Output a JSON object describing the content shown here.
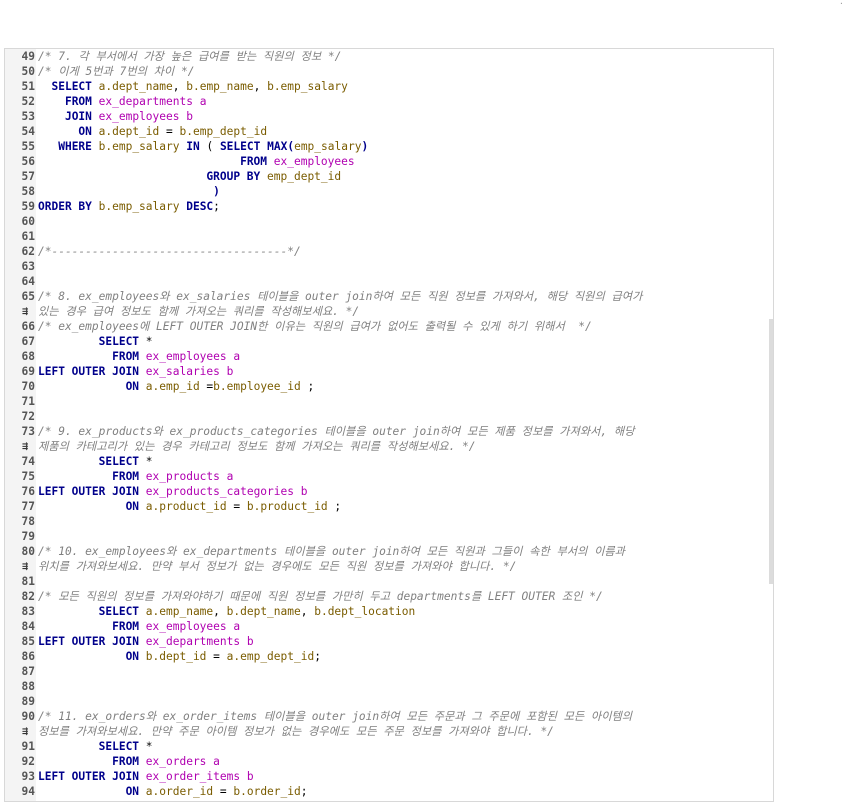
{
  "editor": {
    "lines": [
      {
        "n": "49",
        "t": [
          [
            "cm",
            "/* 7. 각 부서에서 가장 높은 급여를 받는 직원의 정보 */"
          ]
        ]
      },
      {
        "n": "50",
        "t": [
          [
            "cm",
            "/* 이게 5번과 7번의 차이 */"
          ]
        ]
      },
      {
        "n": "51",
        "t": [
          [
            "pl",
            "  "
          ],
          [
            "kw",
            "SELECT"
          ],
          [
            "pl",
            " "
          ],
          [
            "id",
            "a.dept_name"
          ],
          [
            "pl",
            ", "
          ],
          [
            "id",
            "b.emp_name"
          ],
          [
            "pl",
            ", "
          ],
          [
            "id",
            "b.emp_salary"
          ]
        ]
      },
      {
        "n": "52",
        "t": [
          [
            "pl",
            "    "
          ],
          [
            "kw",
            "FROM"
          ],
          [
            "pl",
            " "
          ],
          [
            "tb",
            "ex_departments"
          ],
          [
            "pl",
            " "
          ],
          [
            "tb",
            "a"
          ]
        ]
      },
      {
        "n": "53",
        "t": [
          [
            "pl",
            "    "
          ],
          [
            "kw",
            "JOIN"
          ],
          [
            "pl",
            " "
          ],
          [
            "tb",
            "ex_employees"
          ],
          [
            "pl",
            " "
          ],
          [
            "tb",
            "b"
          ]
        ]
      },
      {
        "n": "54",
        "t": [
          [
            "pl",
            "      "
          ],
          [
            "kw",
            "ON"
          ],
          [
            "pl",
            " "
          ],
          [
            "id",
            "a.dept_id"
          ],
          [
            "pl",
            " = "
          ],
          [
            "id",
            "b.emp_dept_id"
          ]
        ]
      },
      {
        "n": "55",
        "t": [
          [
            "pl",
            "   "
          ],
          [
            "kw",
            "WHERE"
          ],
          [
            "pl",
            " "
          ],
          [
            "id",
            "b.emp_salary"
          ],
          [
            "pl",
            " "
          ],
          [
            "kw",
            "IN"
          ],
          [
            "pl",
            " ( "
          ],
          [
            "kw",
            "SELECT"
          ],
          [
            "pl",
            " "
          ],
          [
            "kw",
            "MAX"
          ],
          [
            "pn",
            "("
          ],
          [
            "id",
            "emp_salary"
          ],
          [
            "pn",
            ")"
          ]
        ]
      },
      {
        "n": "56",
        "t": [
          [
            "pl",
            "                              "
          ],
          [
            "kw",
            "FROM"
          ],
          [
            "pl",
            " "
          ],
          [
            "tb",
            "ex_employees"
          ]
        ]
      },
      {
        "n": "57",
        "t": [
          [
            "pl",
            "                         "
          ],
          [
            "kw",
            "GROUP BY"
          ],
          [
            "pl",
            " "
          ],
          [
            "id",
            "emp_dept_id"
          ]
        ]
      },
      {
        "n": "58",
        "t": [
          [
            "pl",
            "                          "
          ],
          [
            "pn",
            ")"
          ]
        ]
      },
      {
        "n": "59",
        "t": [
          [
            "kw",
            "ORDER BY"
          ],
          [
            "pl",
            " "
          ],
          [
            "id",
            "b.emp_salary"
          ],
          [
            "pl",
            " "
          ],
          [
            "kw",
            "DESC"
          ],
          [
            "pl",
            ";"
          ]
        ]
      },
      {
        "n": "60",
        "t": []
      },
      {
        "n": "61",
        "t": []
      },
      {
        "n": "62",
        "t": [
          [
            "cm",
            "/*-----------------------------------*/"
          ]
        ]
      },
      {
        "n": "63",
        "t": []
      },
      {
        "n": "64",
        "t": []
      },
      {
        "n": "65",
        "t": [
          [
            "cm",
            "/* 8. ex_employees와 ex_salaries 테이블을 outer join하여 모든 직원 정보를 가져와서, 해당 직원의 급여가"
          ]
        ]
      },
      {
        "n": "",
        "w": true,
        "t": [
          [
            "cm",
            "있는 경우 급여 정보도 함께 가져오는 쿼리를 작성해보세요. */"
          ]
        ]
      },
      {
        "n": "66",
        "t": [
          [
            "cm",
            "/* ex_employees에 LEFT OUTER JOIN한 이유는 직원의 급여가 없어도 출력될 수 있게 하기 위해서  */"
          ]
        ]
      },
      {
        "n": "67",
        "t": [
          [
            "pl",
            "         "
          ],
          [
            "kw",
            "SELECT"
          ],
          [
            "pl",
            " *"
          ]
        ]
      },
      {
        "n": "68",
        "t": [
          [
            "pl",
            "           "
          ],
          [
            "kw",
            "FROM"
          ],
          [
            "pl",
            " "
          ],
          [
            "tb",
            "ex_employees"
          ],
          [
            "pl",
            " "
          ],
          [
            "tb",
            "a"
          ]
        ]
      },
      {
        "n": "69",
        "t": [
          [
            "kw",
            "LEFT OUTER JOIN"
          ],
          [
            "pl",
            " "
          ],
          [
            "tb",
            "ex_salaries"
          ],
          [
            "pl",
            " "
          ],
          [
            "tb",
            "b"
          ]
        ]
      },
      {
        "n": "70",
        "t": [
          [
            "pl",
            "             "
          ],
          [
            "kw",
            "ON"
          ],
          [
            "pl",
            " "
          ],
          [
            "id",
            "a.emp_id"
          ],
          [
            "pl",
            " ="
          ],
          [
            "id",
            "b.employee_id"
          ],
          [
            "pl",
            " ;"
          ]
        ]
      },
      {
        "n": "71",
        "t": []
      },
      {
        "n": "72",
        "t": []
      },
      {
        "n": "73",
        "t": [
          [
            "cm",
            "/* 9. ex_products와 ex_products_categories 테이블을 outer join하여 모든 제품 정보를 가져와서, 해당"
          ]
        ]
      },
      {
        "n": "",
        "w": true,
        "t": [
          [
            "cm",
            "제품의 카테고리가 있는 경우 카테고리 정보도 함께 가져오는 쿼리를 작성해보세요. */"
          ]
        ]
      },
      {
        "n": "74",
        "t": [
          [
            "pl",
            "         "
          ],
          [
            "kw",
            "SELECT"
          ],
          [
            "pl",
            " *"
          ]
        ]
      },
      {
        "n": "75",
        "t": [
          [
            "pl",
            "           "
          ],
          [
            "kw",
            "FROM"
          ],
          [
            "pl",
            " "
          ],
          [
            "tb",
            "ex_products"
          ],
          [
            "pl",
            " "
          ],
          [
            "tb",
            "a"
          ]
        ]
      },
      {
        "n": "76",
        "t": [
          [
            "kw",
            "LEFT OUTER JOIN"
          ],
          [
            "pl",
            " "
          ],
          [
            "tb",
            "ex_products_categories"
          ],
          [
            "pl",
            " "
          ],
          [
            "tb",
            "b"
          ]
        ]
      },
      {
        "n": "77",
        "t": [
          [
            "pl",
            "             "
          ],
          [
            "kw",
            "ON"
          ],
          [
            "pl",
            " "
          ],
          [
            "id",
            "a.product_id"
          ],
          [
            "pl",
            " = "
          ],
          [
            "id",
            "b.product_id"
          ],
          [
            "pl",
            " ;"
          ]
        ]
      },
      {
        "n": "78",
        "t": []
      },
      {
        "n": "79",
        "t": []
      },
      {
        "n": "80",
        "t": [
          [
            "cm",
            "/* 10. ex_employees와 ex_departments 테이블을 outer join하여 모든 직원과 그들이 속한 부서의 이름과"
          ]
        ]
      },
      {
        "n": "",
        "w": true,
        "t": [
          [
            "cm",
            "위치를 가져와보세요. 만약 부서 정보가 없는 경우에도 모든 직원 정보를 가져와야 합니다. */"
          ]
        ]
      },
      {
        "n": "81",
        "t": []
      },
      {
        "n": "82",
        "t": [
          [
            "cm",
            "/* 모든 직원의 정보를 가져와야하기 때문에 직원 정보를 가만히 두고 departments를 LEFT OUTER 조인 */"
          ]
        ]
      },
      {
        "n": "83",
        "t": [
          [
            "pl",
            "         "
          ],
          [
            "kw",
            "SELECT"
          ],
          [
            "pl",
            " "
          ],
          [
            "id",
            "a.emp_name"
          ],
          [
            "pl",
            ", "
          ],
          [
            "id",
            "b.dept_name"
          ],
          [
            "pl",
            ", "
          ],
          [
            "id",
            "b.dept_location"
          ]
        ]
      },
      {
        "n": "84",
        "t": [
          [
            "pl",
            "           "
          ],
          [
            "kw",
            "FROM"
          ],
          [
            "pl",
            " "
          ],
          [
            "tb",
            "ex_employees"
          ],
          [
            "pl",
            " "
          ],
          [
            "tb",
            "a"
          ]
        ]
      },
      {
        "n": "85",
        "t": [
          [
            "kw",
            "LEFT OUTER JOIN"
          ],
          [
            "pl",
            " "
          ],
          [
            "tb",
            "ex_departments"
          ],
          [
            "pl",
            " "
          ],
          [
            "tb",
            "b"
          ]
        ]
      },
      {
        "n": "86",
        "t": [
          [
            "pl",
            "             "
          ],
          [
            "kw",
            "ON"
          ],
          [
            "pl",
            " "
          ],
          [
            "id",
            "b.dept_id"
          ],
          [
            "pl",
            " = "
          ],
          [
            "id",
            "a.emp_dept_id"
          ],
          [
            "pl",
            ";"
          ]
        ]
      },
      {
        "n": "87",
        "t": []
      },
      {
        "n": "88",
        "t": []
      },
      {
        "n": "89",
        "t": []
      },
      {
        "n": "90",
        "t": [
          [
            "cm",
            "/* 11. ex_orders와 ex_order_items 테이블을 outer join하여 모든 주문과 그 주문에 포함된 모든 아이템의"
          ]
        ]
      },
      {
        "n": "",
        "w": true,
        "t": [
          [
            "cm",
            "정보를 가져와보세요. 만약 주문 아이템 정보가 없는 경우에도 모든 주문 정보를 가져와야 합니다. */"
          ]
        ]
      },
      {
        "n": "91",
        "t": [
          [
            "pl",
            "         "
          ],
          [
            "kw",
            "SELECT"
          ],
          [
            "pl",
            " *"
          ]
        ]
      },
      {
        "n": "92",
        "t": [
          [
            "pl",
            "           "
          ],
          [
            "kw",
            "FROM"
          ],
          [
            "pl",
            " "
          ],
          [
            "tb",
            "ex_orders"
          ],
          [
            "pl",
            " "
          ],
          [
            "tb",
            "a"
          ]
        ]
      },
      {
        "n": "93",
        "t": [
          [
            "kw",
            "LEFT OUTER JOIN"
          ],
          [
            "pl",
            " "
          ],
          [
            "tb",
            "ex_order_items"
          ],
          [
            "pl",
            " "
          ],
          [
            "tb",
            "b"
          ]
        ]
      },
      {
        "n": "94",
        "t": [
          [
            "pl",
            "             "
          ],
          [
            "kw",
            "ON"
          ],
          [
            "pl",
            " "
          ],
          [
            "id",
            "a.order_id"
          ],
          [
            "pl",
            " = "
          ],
          [
            "id",
            "b.order_id"
          ],
          [
            "pl",
            ";"
          ]
        ]
      }
    ],
    "wrap_icon": "wrap-arrow-icon",
    "colors": {
      "keyword": "#00008b",
      "table": "#b000b0",
      "identifier": "#7a5c00",
      "comment": "#808080",
      "line_number": "#555555",
      "gutter": "#f4f4f4"
    }
  }
}
